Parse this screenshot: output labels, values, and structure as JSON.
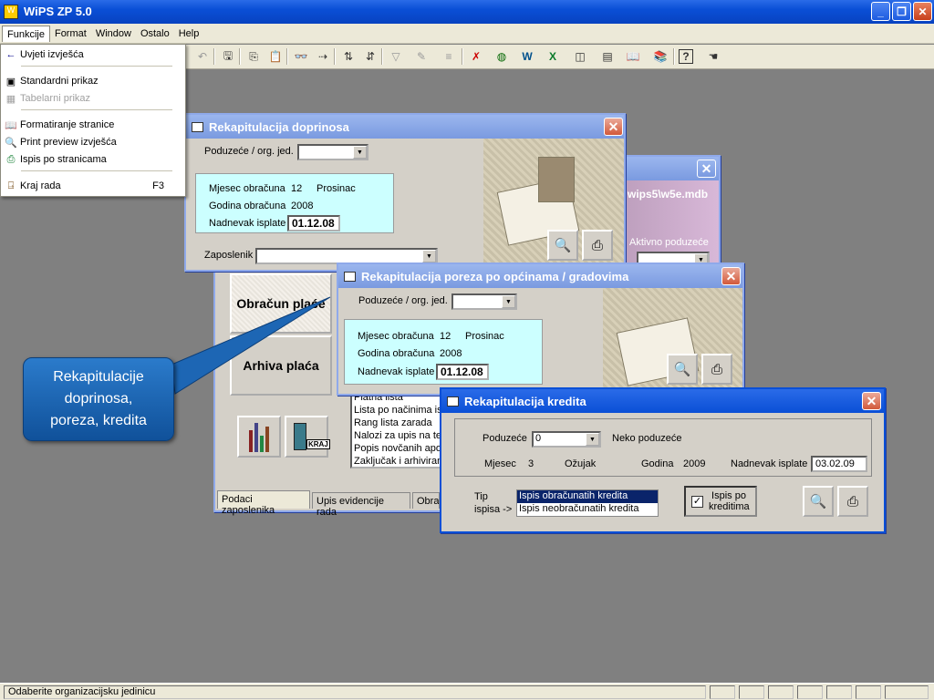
{
  "app": {
    "title": "WiPS ZP 5.0"
  },
  "menu": {
    "items": [
      "Funkcije",
      "Format",
      "Window",
      "Ostalo",
      "Help"
    ]
  },
  "funkcije_menu": {
    "items": [
      {
        "label": "Uvjeti izvješća",
        "icon": "arrow-left-icon",
        "shortcut": "",
        "disabled": false
      },
      {
        "label": "Standardni prikaz",
        "icon": "form-view-icon",
        "shortcut": "",
        "disabled": false
      },
      {
        "label": "Tabelarni prikaz",
        "icon": "table-view-icon",
        "shortcut": "",
        "disabled": true
      },
      {
        "label": "Formatiranje stranice",
        "icon": "page-setup-icon",
        "shortcut": "",
        "disabled": false
      },
      {
        "label": "Print preview izvješća",
        "icon": "print-preview-icon",
        "shortcut": "",
        "disabled": false
      },
      {
        "label": "Ispis po stranicama",
        "icon": "printer-icon",
        "shortcut": "",
        "disabled": false
      },
      {
        "label": "Kraj rada",
        "icon": "exit-door-icon",
        "shortcut": "F3",
        "disabled": false
      }
    ]
  },
  "doprinosi": {
    "title": "Rekapitulacija doprinosa",
    "poduzece_label": "Poduzeće / org. jed.",
    "mjesec_label": "Mjesec obračuna",
    "mjesec_value": "12",
    "mjesec_name": "Prosinac",
    "godina_label": "Godina obračuna",
    "godina_value": "2008",
    "nadnevak_label": "Nadnevak isplate",
    "nadnevak_value": "01.12.08",
    "zaposlenik_label": "Zaposlenik"
  },
  "back_window": {
    "db_text": "wips5\\w5e.mdb",
    "aktivno_label": "Aktivno poduzeće"
  },
  "porez": {
    "title": "Rekapitulacija poreza po općinama / gradovima",
    "poduzece_label": "Poduzeće / org. jed.",
    "mjesec_label": "Mjesec obračuna",
    "mjesec_value": "12",
    "mjesec_name": "Prosinac",
    "godina_label": "Godina obračuna",
    "godina_value": "2008",
    "nadnevak_label": "Nadnevak isplate",
    "nadnevak_value": "01.12.08"
  },
  "main_form": {
    "obracun_label": "Obračun plaće",
    "arhiva_label": "Arhiva plaća",
    "kraj_label": "KRAJ",
    "list_items": [
      "Platna lista",
      "Lista po načinima isp",
      "Rang lista zarada",
      "Nalozi za upis na tek",
      "Popis novčanih apo",
      "Zaključak i arhiviran"
    ],
    "tabs": [
      "Podaci zaposlenika",
      "Upis evidencije rada",
      "Obrač"
    ]
  },
  "kredit": {
    "title": "Rekapitulacija kredita",
    "poduzece_label": "Poduzeće",
    "poduzece_value": "0",
    "poduzece_name": "Neko poduzeće",
    "mjesec_label": "Mjesec",
    "mjesec_value": "3",
    "mjesec_name": "Ožujak",
    "godina_label": "Godina",
    "godina_value": "2009",
    "nadnevak_label": "Nadnevak isplate",
    "nadnevak_value": "03.02.09",
    "tip_label_1": "Tip",
    "tip_label_2": "ispisa ->",
    "tip_options": [
      "Ispis obračunatih kredita",
      "Ispis neobračunatih kredita"
    ],
    "tip_selected": 0,
    "checkbox_label": "Ispis po kreditima",
    "checkbox_checked": true
  },
  "callout": {
    "text": "Rekapitulacije doprinosa, poreza, kredita"
  },
  "status": {
    "text": "Odaberite organizacijsku jedinicu"
  }
}
